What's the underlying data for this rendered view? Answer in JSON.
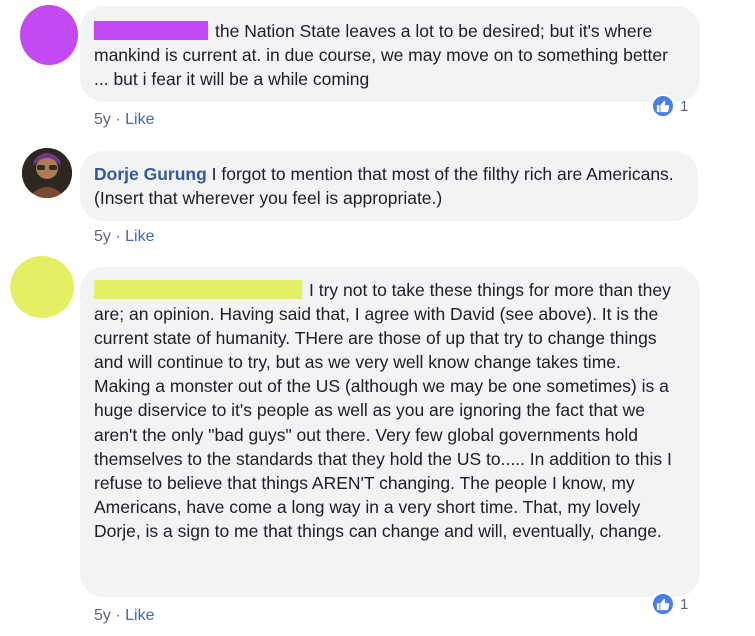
{
  "comments": [
    {
      "author": "",
      "text": "the Nation State leaves a lot to be desired; but it's where mankind is current at. in due course, we may move on to something better ... but i fear it will be a while coming",
      "time": "5y",
      "like_label": "Like",
      "reaction_count": "1",
      "avatar_color": "#c349f1",
      "redaction_color": "#c349f1"
    },
    {
      "author": "Dorje Gurung",
      "text": "I forgot to mention that most of the filthy rich are Americans. (Insert that wherever you feel is appropriate.)",
      "time": "5y",
      "like_label": "Like"
    },
    {
      "author": "",
      "text": "I try not to take these things for more than they are; an opinion. Having said that, I agree with David (see above). It is the current state of humanity. THere are those of up that try to change things and will continue to try, but as we very well know change takes time. Making a monster out of the US (although we may be one sometimes) is a huge diservice to it's people as well as you are ignoring the fact that we aren't the only \"bad guys\" out there. Very few global governments hold themselves to the standards that they hold the US to..... In addition to this I refuse to believe that things AREN'T changing. The people I know, my Americans, have come a long way in a very short time. That, my lovely Dorje, is a sign to me that things can change and will, eventually, change.",
      "time": "5y",
      "like_label": "Like",
      "reaction_count": "1",
      "avatar_color": "#e5ef64",
      "redaction_color": "#e5ef64"
    }
  ],
  "separator": "·",
  "icons": {
    "reaction": "thumbs-up-icon"
  },
  "colors": {
    "link": "#4267b2",
    "author": "#365899",
    "bubble": "#f2f3f5",
    "reaction": "#4a7fe6"
  }
}
